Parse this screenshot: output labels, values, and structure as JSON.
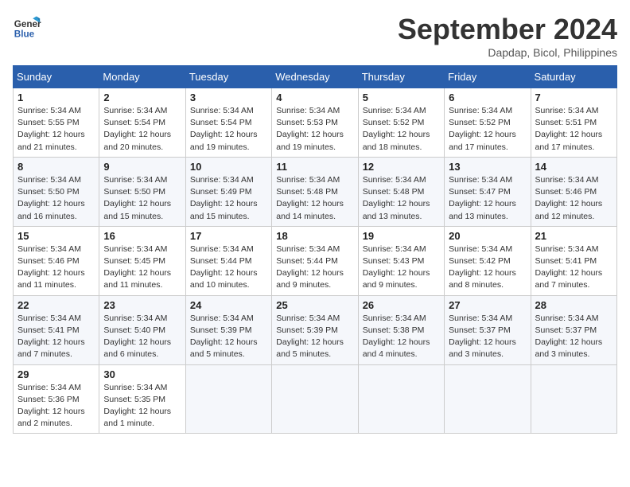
{
  "header": {
    "logo_line1": "General",
    "logo_line2": "Blue",
    "month_title": "September 2024",
    "location": "Dapdap, Bicol, Philippines"
  },
  "weekdays": [
    "Sunday",
    "Monday",
    "Tuesday",
    "Wednesday",
    "Thursday",
    "Friday",
    "Saturday"
  ],
  "weeks": [
    [
      {
        "day": "1",
        "sunrise": "5:34 AM",
        "sunset": "5:55 PM",
        "daylight": "12 hours and 21 minutes."
      },
      {
        "day": "2",
        "sunrise": "5:34 AM",
        "sunset": "5:54 PM",
        "daylight": "12 hours and 20 minutes."
      },
      {
        "day": "3",
        "sunrise": "5:34 AM",
        "sunset": "5:54 PM",
        "daylight": "12 hours and 19 minutes."
      },
      {
        "day": "4",
        "sunrise": "5:34 AM",
        "sunset": "5:53 PM",
        "daylight": "12 hours and 19 minutes."
      },
      {
        "day": "5",
        "sunrise": "5:34 AM",
        "sunset": "5:52 PM",
        "daylight": "12 hours and 18 minutes."
      },
      {
        "day": "6",
        "sunrise": "5:34 AM",
        "sunset": "5:52 PM",
        "daylight": "12 hours and 17 minutes."
      },
      {
        "day": "7",
        "sunrise": "5:34 AM",
        "sunset": "5:51 PM",
        "daylight": "12 hours and 17 minutes."
      }
    ],
    [
      {
        "day": "8",
        "sunrise": "5:34 AM",
        "sunset": "5:50 PM",
        "daylight": "12 hours and 16 minutes."
      },
      {
        "day": "9",
        "sunrise": "5:34 AM",
        "sunset": "5:50 PM",
        "daylight": "12 hours and 15 minutes."
      },
      {
        "day": "10",
        "sunrise": "5:34 AM",
        "sunset": "5:49 PM",
        "daylight": "12 hours and 15 minutes."
      },
      {
        "day": "11",
        "sunrise": "5:34 AM",
        "sunset": "5:48 PM",
        "daylight": "12 hours and 14 minutes."
      },
      {
        "day": "12",
        "sunrise": "5:34 AM",
        "sunset": "5:48 PM",
        "daylight": "12 hours and 13 minutes."
      },
      {
        "day": "13",
        "sunrise": "5:34 AM",
        "sunset": "5:47 PM",
        "daylight": "12 hours and 13 minutes."
      },
      {
        "day": "14",
        "sunrise": "5:34 AM",
        "sunset": "5:46 PM",
        "daylight": "12 hours and 12 minutes."
      }
    ],
    [
      {
        "day": "15",
        "sunrise": "5:34 AM",
        "sunset": "5:46 PM",
        "daylight": "12 hours and 11 minutes."
      },
      {
        "day": "16",
        "sunrise": "5:34 AM",
        "sunset": "5:45 PM",
        "daylight": "12 hours and 11 minutes."
      },
      {
        "day": "17",
        "sunrise": "5:34 AM",
        "sunset": "5:44 PM",
        "daylight": "12 hours and 10 minutes."
      },
      {
        "day": "18",
        "sunrise": "5:34 AM",
        "sunset": "5:44 PM",
        "daylight": "12 hours and 9 minutes."
      },
      {
        "day": "19",
        "sunrise": "5:34 AM",
        "sunset": "5:43 PM",
        "daylight": "12 hours and 9 minutes."
      },
      {
        "day": "20",
        "sunrise": "5:34 AM",
        "sunset": "5:42 PM",
        "daylight": "12 hours and 8 minutes."
      },
      {
        "day": "21",
        "sunrise": "5:34 AM",
        "sunset": "5:41 PM",
        "daylight": "12 hours and 7 minutes."
      }
    ],
    [
      {
        "day": "22",
        "sunrise": "5:34 AM",
        "sunset": "5:41 PM",
        "daylight": "12 hours and 7 minutes."
      },
      {
        "day": "23",
        "sunrise": "5:34 AM",
        "sunset": "5:40 PM",
        "daylight": "12 hours and 6 minutes."
      },
      {
        "day": "24",
        "sunrise": "5:34 AM",
        "sunset": "5:39 PM",
        "daylight": "12 hours and 5 minutes."
      },
      {
        "day": "25",
        "sunrise": "5:34 AM",
        "sunset": "5:39 PM",
        "daylight": "12 hours and 5 minutes."
      },
      {
        "day": "26",
        "sunrise": "5:34 AM",
        "sunset": "5:38 PM",
        "daylight": "12 hours and 4 minutes."
      },
      {
        "day": "27",
        "sunrise": "5:34 AM",
        "sunset": "5:37 PM",
        "daylight": "12 hours and 3 minutes."
      },
      {
        "day": "28",
        "sunrise": "5:34 AM",
        "sunset": "5:37 PM",
        "daylight": "12 hours and 3 minutes."
      }
    ],
    [
      {
        "day": "29",
        "sunrise": "5:34 AM",
        "sunset": "5:36 PM",
        "daylight": "12 hours and 2 minutes."
      },
      {
        "day": "30",
        "sunrise": "5:34 AM",
        "sunset": "5:35 PM",
        "daylight": "12 hours and 1 minute."
      },
      null,
      null,
      null,
      null,
      null
    ]
  ]
}
